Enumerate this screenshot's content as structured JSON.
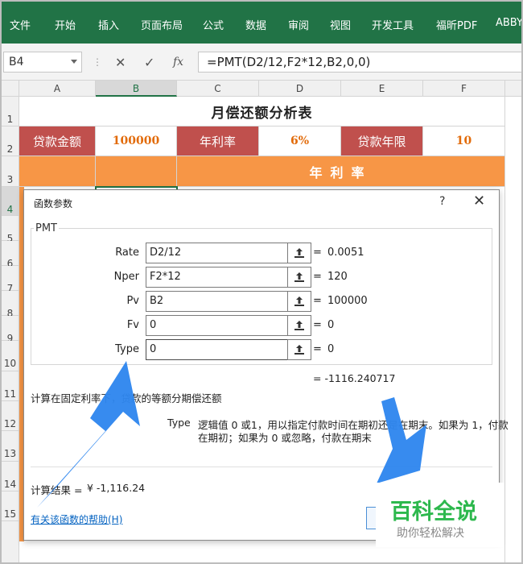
{
  "ribbon": {
    "tabs": [
      "文件",
      "开始",
      "插入",
      "页面布局",
      "公式",
      "数据",
      "审阅",
      "视图",
      "开发工具",
      "福昕PDF",
      "ABBY"
    ]
  },
  "formula_bar": {
    "name_box": "B4",
    "fx_symbol": "fx",
    "cancel_symbol": "✕",
    "enter_symbol": "✓",
    "formula": "=PMT(D2/12,F2*12,B2,0,0)"
  },
  "columns": [
    "A",
    "B",
    "C",
    "D",
    "E",
    "F"
  ],
  "rows": [
    "1",
    "2",
    "3",
    "4",
    "5",
    "6",
    "7",
    "8",
    "9",
    "10",
    "11",
    "12",
    "13",
    "14",
    "15"
  ],
  "sheet": {
    "title": "月偿还额分析表",
    "loan_amount_label": "贷款金额",
    "loan_amount_value": "100000",
    "rate_label": "年利率",
    "rate_value": "6%",
    "years_label": "贷款年限",
    "years_value": "10",
    "rate_header": "年利率"
  },
  "dialog": {
    "title": "函数参数",
    "help_symbol": "?",
    "close_symbol": "✕",
    "function_name": "PMT",
    "args": [
      {
        "label": "Rate",
        "input": "D2/12",
        "result": "0.0051"
      },
      {
        "label": "Nper",
        "input": "F2*12",
        "result": "120"
      },
      {
        "label": "Pv",
        "input": "B2",
        "result": "100000"
      },
      {
        "label": "Fv",
        "input": "0",
        "result": "0"
      },
      {
        "label": "Type",
        "input": "0",
        "result": "0"
      }
    ],
    "equals": "=",
    "total_result": "= -1116.240717",
    "description": "计算在固定利率下，贷款的等额分期偿还额",
    "arg_help_name": "Type",
    "arg_help_line1": "逻辑值 0 或1，用以指定付款时间在期初还是在期末。如果为 1，付款",
    "arg_help_line2": "在期初；如果为 0 或忽略，付款在期末",
    "calc_result_label": "计算结果 =",
    "calc_result_value": "¥ -1,116.24",
    "help_link": "有关该函数的帮助(H)"
  },
  "watermark": {
    "title": "百科全说",
    "subtitle": "助你轻松解决"
  },
  "colors": {
    "ribbon": "#217346",
    "label_red": "#c0504d",
    "header_orange": "#f79646",
    "value_orange": "#e26b0a",
    "arrow_blue": "#2f86ee",
    "watermark_green": "#2db84d"
  }
}
